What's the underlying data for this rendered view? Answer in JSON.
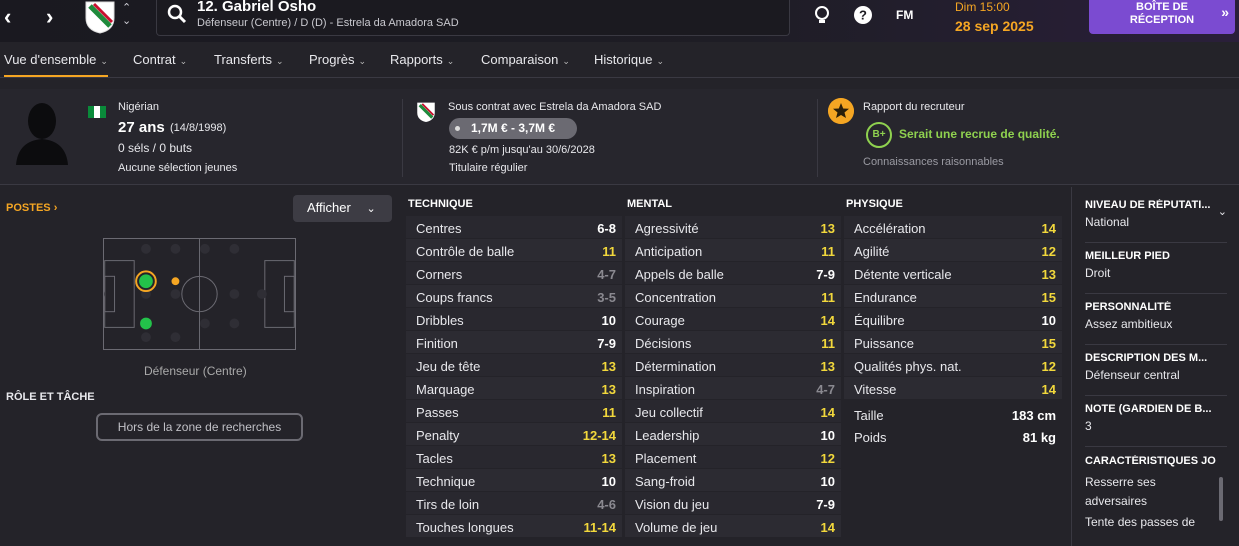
{
  "header": {
    "player_name": "12. Gabriel Osho",
    "player_sub": "Défenseur (Centre) / D (D) - Estrela da Amadora SAD",
    "fm_label": "FM",
    "date_line1": "Dim 15:00",
    "date_line2": "28 sep 2025",
    "inbox_line1": "BOÎTE DE",
    "inbox_line2": "RÉCEPTION"
  },
  "tabs": [
    {
      "label": "Vue d'ensemble"
    },
    {
      "label": "Contrat"
    },
    {
      "label": "Transferts"
    },
    {
      "label": "Progrès"
    },
    {
      "label": "Rapports"
    },
    {
      "label": "Comparaison"
    },
    {
      "label": "Historique"
    }
  ],
  "overview": {
    "nationality": "Nigérian",
    "age": "27 ans",
    "dob": "(14/8/1998)",
    "caps": "0 séls / 0 buts",
    "youth": "Aucune sélection jeunes",
    "contract": "Sous contrat avec Estrela da Amadora SAD",
    "value": "1,7M € - 3,7M €",
    "wage": "82K € p/m jusqu'au 30/6/2028",
    "status": "Titulaire régulier",
    "scout_title": "Rapport du recruteur",
    "scout_grade": "B+",
    "scout_verdict": "Serait une recrue de qualité.",
    "knowledge": "Connaissances raisonnables"
  },
  "positions": {
    "title": "POSTES",
    "afficher": "Afficher",
    "label": "Défenseur (Centre)",
    "role_title": "RÔLE ET TÂCHE",
    "role_value": "Hors de la zone de recherches"
  },
  "attributes": {
    "technique": {
      "title": "TECHNIQUE",
      "rows": [
        {
          "name": "Centres",
          "value": "6-8",
          "tone": "vw"
        },
        {
          "name": "Contrôle de balle",
          "value": "11",
          "tone": "vy"
        },
        {
          "name": "Corners",
          "value": "4-7",
          "tone": "vg"
        },
        {
          "name": "Coups francs",
          "value": "3-5",
          "tone": "vg"
        },
        {
          "name": "Dribbles",
          "value": "10",
          "tone": "vw"
        },
        {
          "name": "Finition",
          "value": "7-9",
          "tone": "vw"
        },
        {
          "name": "Jeu de tête",
          "value": "13",
          "tone": "vy"
        },
        {
          "name": "Marquage",
          "value": "13",
          "tone": "vy"
        },
        {
          "name": "Passes",
          "value": "11",
          "tone": "vy"
        },
        {
          "name": "Penalty",
          "value": "12-14",
          "tone": "vy"
        },
        {
          "name": "Tacles",
          "value": "13",
          "tone": "vy"
        },
        {
          "name": "Technique",
          "value": "10",
          "tone": "vw"
        },
        {
          "name": "Tirs de loin",
          "value": "4-6",
          "tone": "vg"
        },
        {
          "name": "Touches longues",
          "value": "11-14",
          "tone": "vy"
        }
      ]
    },
    "mental": {
      "title": "MENTAL",
      "rows": [
        {
          "name": "Agressivité",
          "value": "13",
          "tone": "vy"
        },
        {
          "name": "Anticipation",
          "value": "11",
          "tone": "vy"
        },
        {
          "name": "Appels de balle",
          "value": "7-9",
          "tone": "vw"
        },
        {
          "name": "Concentration",
          "value": "11",
          "tone": "vy"
        },
        {
          "name": "Courage",
          "value": "14",
          "tone": "vy"
        },
        {
          "name": "Décisions",
          "value": "11",
          "tone": "vy"
        },
        {
          "name": "Détermination",
          "value": "13",
          "tone": "vy"
        },
        {
          "name": "Inspiration",
          "value": "4-7",
          "tone": "vg"
        },
        {
          "name": "Jeu collectif",
          "value": "14",
          "tone": "vy"
        },
        {
          "name": "Leadership",
          "value": "10",
          "tone": "vw"
        },
        {
          "name": "Placement",
          "value": "12",
          "tone": "vy"
        },
        {
          "name": "Sang-froid",
          "value": "10",
          "tone": "vw"
        },
        {
          "name": "Vision du jeu",
          "value": "7-9",
          "tone": "vw"
        },
        {
          "name": "Volume de jeu",
          "value": "14",
          "tone": "vy"
        }
      ]
    },
    "physique": {
      "title": "PHYSIQUE",
      "rows": [
        {
          "name": "Accélération",
          "value": "14",
          "tone": "vy"
        },
        {
          "name": "Agilité",
          "value": "12",
          "tone": "vy"
        },
        {
          "name": "Détente verticale",
          "value": "13",
          "tone": "vy"
        },
        {
          "name": "Endurance",
          "value": "15",
          "tone": "vy"
        },
        {
          "name": "Équilibre",
          "value": "10",
          "tone": "vw"
        },
        {
          "name": "Puissance",
          "value": "15",
          "tone": "vy"
        },
        {
          "name": "Qualités phys. nat.",
          "value": "12",
          "tone": "vy"
        },
        {
          "name": "Vitesse",
          "value": "14",
          "tone": "vy"
        }
      ],
      "extras": [
        {
          "name": "Taille",
          "value": "183 cm"
        },
        {
          "name": "Poids",
          "value": "81 kg"
        }
      ]
    }
  },
  "side": [
    {
      "title": "NIVEAU DE RÉPUTATI...",
      "value": "National"
    },
    {
      "title": "MEILLEUR PIED",
      "value": "Droit"
    },
    {
      "title": "PERSONNALITÉ",
      "value": "Assez ambitieux"
    },
    {
      "title": "DESCRIPTION DES M...",
      "value": "Défenseur central"
    },
    {
      "title": "NOTE (GARDIEN DE B...",
      "value": "3"
    },
    {
      "title": "CARACTÉRISTIQUES JO",
      "value": "Resserre ses adversaires",
      "value2": "Tente des passes de"
    }
  ],
  "colors": {
    "accent": "#f5a623",
    "inbox": "#7b4bd1",
    "yellow": "#f2d83c",
    "green": "#8fd14f"
  }
}
